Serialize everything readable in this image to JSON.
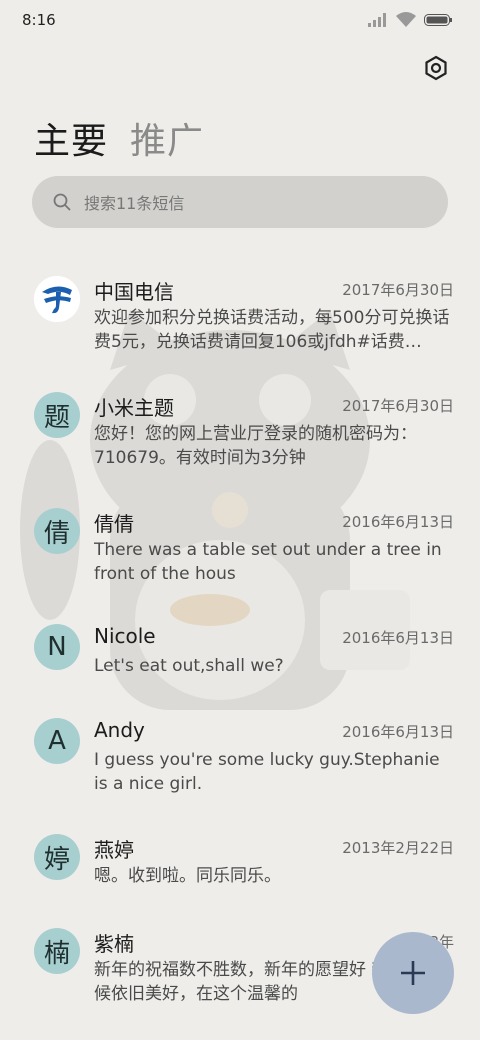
{
  "status_bar": {
    "time": "8:16"
  },
  "tabs": [
    {
      "label": "主要",
      "active": true
    },
    {
      "label": "推广",
      "active": false
    }
  ],
  "search": {
    "placeholder": "搜索11条短信"
  },
  "conversations": [
    {
      "avatar": "",
      "avatar_type": "china-telecom-logo",
      "name": "中国电信",
      "date": "2017年6月30日",
      "preview": "欢迎参加积分兑换话费活动，每500分可兑换话费5元，兑换话费请回复106或jfdh#话费…"
    },
    {
      "avatar": "题",
      "avatar_type": "letter",
      "name": "小米主题",
      "date": "2017年6月30日",
      "preview": "您好！您的网上营业厅登录的随机密码为：710679。有效时间为3分钟"
    },
    {
      "avatar": "倩",
      "avatar_type": "letter",
      "name": "倩倩",
      "date": "2016年6月13日",
      "preview": "There was a table set out under a tree in front of the hous"
    },
    {
      "avatar": "N",
      "avatar_type": "letter",
      "name": "Nicole",
      "date": "2016年6月13日",
      "preview": "Let's eat out,shall we?"
    },
    {
      "avatar": "A",
      "avatar_type": "letter",
      "name": "Andy",
      "date": "2016年6月13日",
      "preview": "I guess you're some lucky guy.Stephanie is a nice girl."
    },
    {
      "avatar": "婷",
      "avatar_type": "letter",
      "name": "燕婷",
      "date": "2013年2月22日",
      "preview": "嗯。收到啦。同乐同乐。"
    },
    {
      "avatar": "楠",
      "avatar_type": "letter",
      "name": "紫楠",
      "date": "2013年",
      "preview": "新年的祝福数不胜数，新年的愿望好 新年的问候依旧美好，在这个温馨的"
    }
  ],
  "colors": {
    "background": "#eeedea",
    "avatar_bg": "#a8cfcf",
    "search_bg": "#d2d1ce",
    "fab_bg": "#a9b8cd"
  }
}
